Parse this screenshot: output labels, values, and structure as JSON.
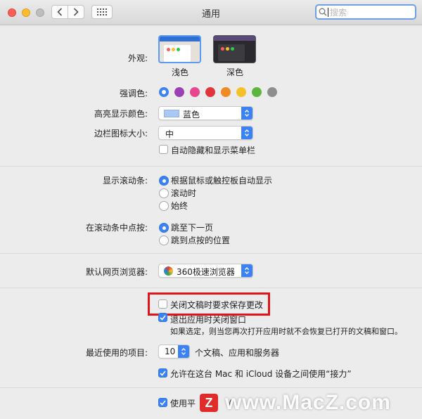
{
  "window": {
    "title": "通用"
  },
  "search": {
    "placeholder": "搜索"
  },
  "appearance": {
    "label": "外观:",
    "options": [
      {
        "name": "浅色",
        "selected": true
      },
      {
        "name": "深色",
        "selected": false
      }
    ]
  },
  "accent": {
    "label": "强调色:",
    "colors": [
      "#3b82f6",
      "#9b3fb5",
      "#e8478f",
      "#e0353a",
      "#f08a24",
      "#f5c12b",
      "#5bb53f",
      "#8e8e8e"
    ],
    "selected_index": 0
  },
  "highlight": {
    "label": "高亮显示颜色:",
    "value": "蓝色",
    "swatch": "#a9c8f3"
  },
  "sidebar_icon": {
    "label": "边栏图标大小:",
    "value": "中",
    "autohide_label": "自动隐藏和显示菜单栏",
    "autohide_checked": false
  },
  "scrollbars": {
    "label": "显示滚动条:",
    "options": [
      "根据鼠标或触控板自动显示",
      "滚动时",
      "始终"
    ],
    "selected_index": 0
  },
  "click_scroll": {
    "label": "在滚动条中点按:",
    "options": [
      "跳至下一页",
      "跳到点按的位置"
    ],
    "selected_index": 0
  },
  "browser": {
    "label": "默认网页浏览器:",
    "value": "360极速浏览器"
  },
  "documents": {
    "ask_save_label": "关闭文稿时要求保存更改",
    "ask_save_checked": false,
    "close_windows_label": "退出应用时关闭窗口",
    "close_windows_checked": true,
    "close_windows_note": "如果选定，则当您再次打开应用时就不会恢复已打开的文稿和窗口。"
  },
  "recent": {
    "label": "最近使用的项目:",
    "count": "10",
    "suffix": "个文稿、应用和服务器",
    "handoff_label": "允许在这台 Mac 和 iCloud 设备之间使用“接力”",
    "handoff_checked": true
  },
  "font_smoothing": {
    "label_fragment": "使用平",
    "checked": true,
    "trailing": "（"
  },
  "watermark": {
    "logo": "Z",
    "text": "www.MacZ.com"
  }
}
